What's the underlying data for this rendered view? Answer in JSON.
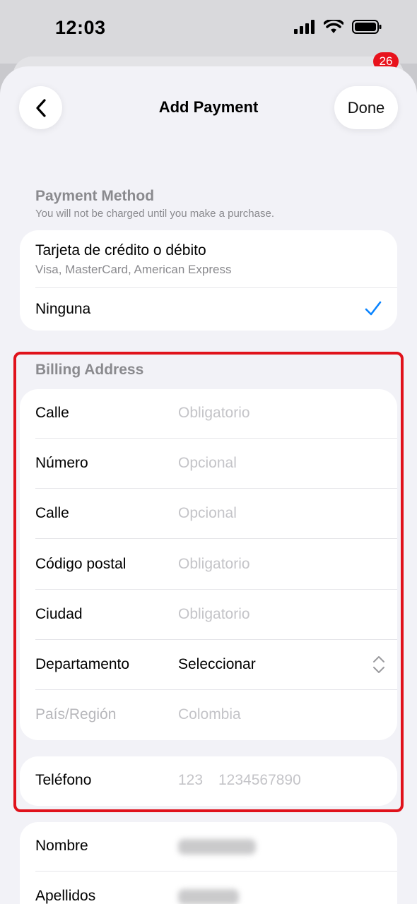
{
  "status_bar": {
    "time": "12:03"
  },
  "background": {
    "badge": "26"
  },
  "nav": {
    "title": "Add Payment",
    "done_label": "Done"
  },
  "payment_method": {
    "title": "Payment Method",
    "subtitle": "You will not be charged until you make a purchase.",
    "options": [
      {
        "label": "Tarjeta de crédito o débito",
        "detail": "Visa, MasterCard, American Express",
        "selected": false
      },
      {
        "label": "Ninguna",
        "selected": true
      }
    ]
  },
  "billing_address": {
    "title": "Billing Address",
    "fields": [
      {
        "label": "Calle",
        "placeholder": "Obligatorio"
      },
      {
        "label": "Número",
        "placeholder": "Opcional"
      },
      {
        "label": "Calle",
        "placeholder": "Opcional"
      },
      {
        "label": "Código postal",
        "placeholder": "Obligatorio"
      },
      {
        "label": "Ciudad",
        "placeholder": "Obligatorio"
      },
      {
        "label": "Departamento",
        "value": "Seleccionar"
      },
      {
        "label": "País/Región",
        "value": "Colombia"
      }
    ],
    "phone": {
      "label": "Teléfono",
      "code_placeholder": "123",
      "number_placeholder": "1234567890"
    }
  },
  "name_section": {
    "fields": [
      {
        "label": "Nombre"
      },
      {
        "label": "Apellidos"
      }
    ]
  },
  "colors": {
    "accent": "#0a84ff",
    "highlight": "#e0121b",
    "muted": "#8a8a8e"
  }
}
